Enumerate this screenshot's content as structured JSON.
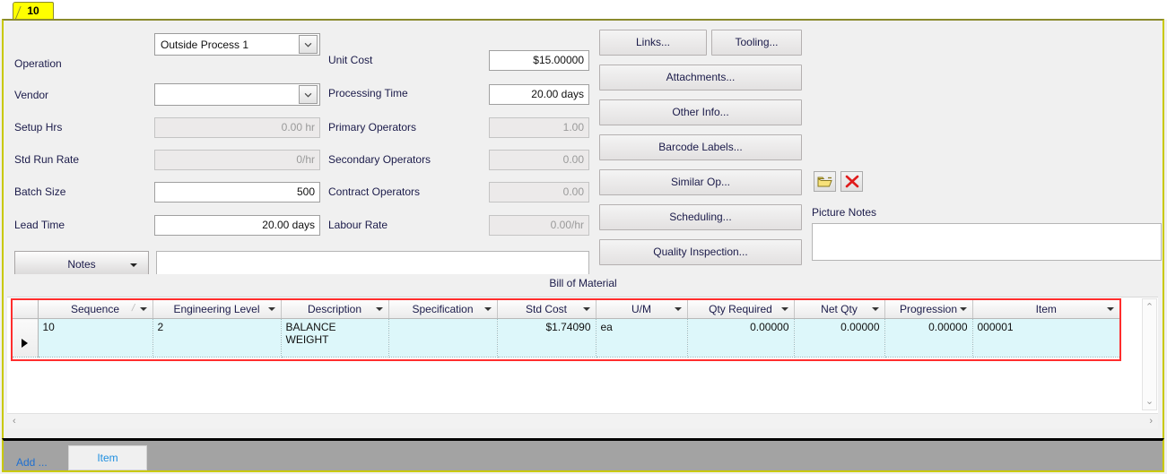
{
  "window": {
    "tab_label": "10",
    "accent_border": "#c9c900",
    "grid_highlight_border": "#ff2d2d",
    "row_fill": "#ddf7fa"
  },
  "form": {
    "left_column": [
      {
        "label": "Operation",
        "type": "combo",
        "value": "Outside Process 1",
        "readonly": false
      },
      {
        "label": "Vendor",
        "type": "combo",
        "value": "",
        "readonly": false
      },
      {
        "label": "Setup Hrs",
        "type": "text",
        "value": "0.00 hr",
        "readonly": true
      },
      {
        "label": "Std Run Rate",
        "type": "text",
        "value": "0/hr",
        "readonly": true
      },
      {
        "label": "Batch Size",
        "type": "text",
        "value": "500",
        "readonly": false
      },
      {
        "label": "Lead Time",
        "type": "text",
        "value": "20.00 days",
        "readonly": false
      }
    ],
    "middle_column": [
      {
        "label": "Unit Cost",
        "value": "$15.00000",
        "readonly": false
      },
      {
        "label": "Processing Time",
        "value": "20.00 days",
        "readonly": false
      },
      {
        "label": "Primary Operators",
        "value": "1.00",
        "readonly": true
      },
      {
        "label": "Secondary Operators",
        "value": "0.00",
        "readonly": true
      },
      {
        "label": "Contract Operators",
        "value": "0.00",
        "readonly": true
      },
      {
        "label": "Labour Rate",
        "value": "0.00/hr",
        "readonly": true
      }
    ],
    "buttons": {
      "links": "Links...",
      "tooling": "Tooling...",
      "attachments": "Attachments...",
      "other_info": "Other Info...",
      "barcode_labels": "Barcode Labels...",
      "similar_op": "Similar Op...",
      "scheduling": "Scheduling...",
      "quality_inspection": "Quality Inspection..."
    },
    "notes_button": "Notes",
    "notes_value": "",
    "picture_notes_label": "Picture Notes",
    "picture_notes_value": "",
    "picture_open_icon": "open-folder-icon",
    "picture_delete_icon": "red-x-icon"
  },
  "bom": {
    "title": "Bill of Material",
    "columns": [
      {
        "label": "Sequence",
        "sorted": true
      },
      {
        "label": "Engineering Level",
        "sorted": false
      },
      {
        "label": "Description",
        "sorted": false
      },
      {
        "label": "Specification",
        "sorted": false
      },
      {
        "label": "Std Cost",
        "sorted": false
      },
      {
        "label": "U/M",
        "sorted": false
      },
      {
        "label": "Qty Required",
        "sorted": false
      },
      {
        "label": "Net Qty",
        "sorted": false
      },
      {
        "label": "Progression",
        "sorted": false
      },
      {
        "label": "Item",
        "sorted": false
      }
    ],
    "rows": [
      {
        "selector": "▶",
        "sequence": "10",
        "engineering_level": "2",
        "description": "BALANCE\nWEIGHT",
        "specification": "",
        "std_cost": "$1.74090",
        "um": "ea",
        "qty_required": "0.00000",
        "net_qty": "0.00000",
        "progression": "0.00000",
        "item": "000001"
      }
    ]
  },
  "scrollbars": {
    "v_up": "⌃",
    "v_down": "⌄",
    "h_left": "‹",
    "h_right": "›"
  },
  "bottom": {
    "add_label": "Add ...",
    "item_tab": "Item"
  }
}
